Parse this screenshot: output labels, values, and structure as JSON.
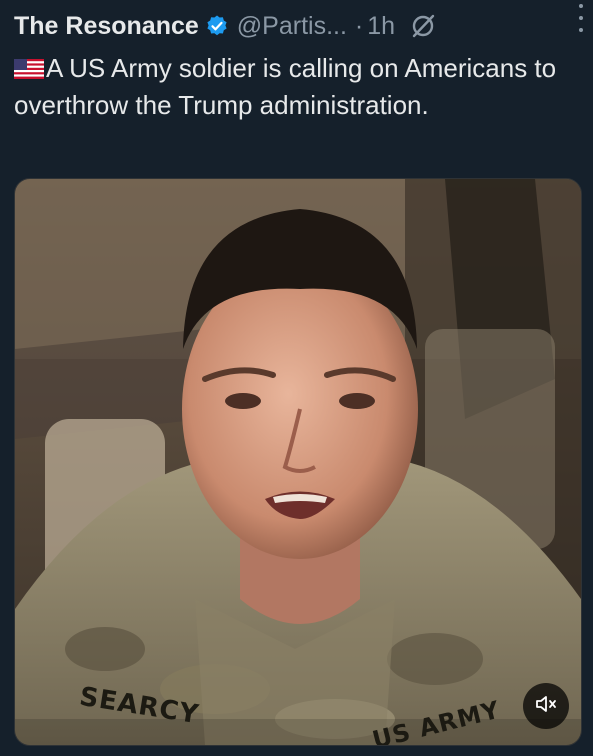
{
  "tweet": {
    "author_name": "The Resonance",
    "handle": "@Partis...",
    "separator": "·",
    "time": "1h",
    "text": "A US Army soldier is calling on Americans to overthrow the Trump administration."
  },
  "icons": {
    "verified": "verified-badge-icon",
    "grok": "grok-icon",
    "more": "more-options-icon",
    "flag": "us-flag-icon",
    "mute": "muted-speaker-icon"
  },
  "media": {
    "name_tape": "SEARCY",
    "branch_tape": "US ARMY"
  },
  "colors": {
    "background": "#15202b",
    "text": "#e7e9ea",
    "secondary_text": "#8b98a5",
    "verified_blue": "#1d9bf0"
  }
}
